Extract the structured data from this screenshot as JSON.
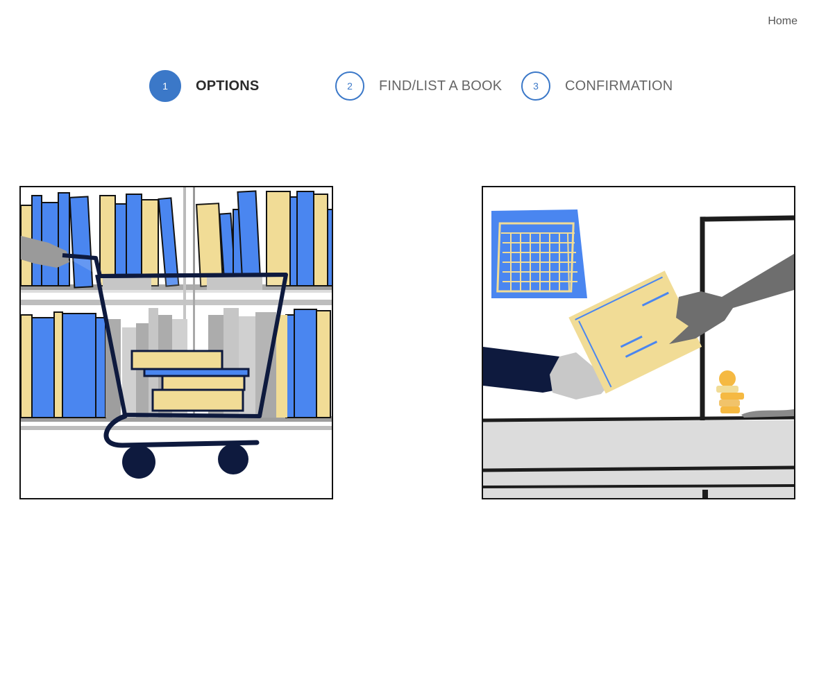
{
  "header": {
    "home_label": "Home"
  },
  "stepper": {
    "steps": [
      {
        "number": "1",
        "label": "OPTIONS",
        "state": "active"
      },
      {
        "number": "2",
        "label": "FIND/LIST A BOOK",
        "state": "inactive"
      },
      {
        "number": "3",
        "label": "CONFIRMATION",
        "state": "inactive"
      }
    ]
  },
  "options": [
    {
      "illustration": "shopping-cart-with-books",
      "option": "buy"
    },
    {
      "illustration": "handing-over-book-at-counter",
      "option": "sell"
    }
  ],
  "colors": {
    "accent": "#3b78c8",
    "book_blue": "#4a86f0",
    "book_yellow": "#f1dc96",
    "navy": "#0e1a3e",
    "gray": "#bdbdbd"
  }
}
